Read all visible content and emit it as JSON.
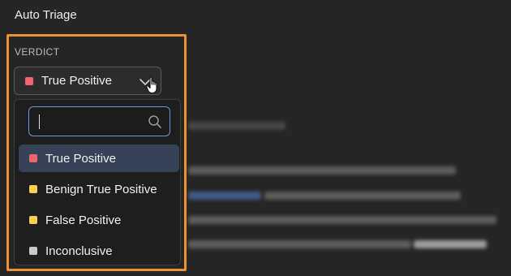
{
  "header": {
    "title": "Auto Triage"
  },
  "verdict": {
    "label": "VERDICT",
    "selected": {
      "label": "True Positive",
      "color": "#f2646a"
    },
    "search": {
      "placeholder": ""
    },
    "options": [
      {
        "label": "True Positive",
        "color": "#f2646a",
        "selected": true
      },
      {
        "label": "Benign True Positive",
        "color": "#f5cf4f",
        "selected": false
      },
      {
        "label": "False Positive",
        "color": "#f5cf4f",
        "selected": false
      },
      {
        "label": "Inconclusive",
        "color": "#c9c9c9",
        "selected": false
      }
    ]
  },
  "colors": {
    "accent_border": "#f0912b",
    "search_border": "#6f95d6",
    "selected_bg": "#354257"
  }
}
